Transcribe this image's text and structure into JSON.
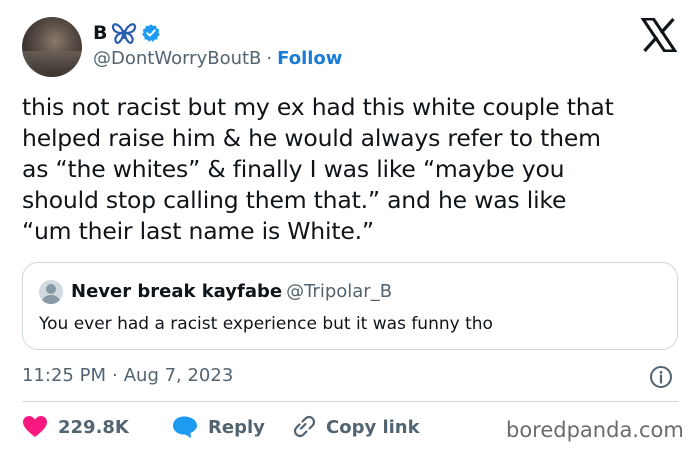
{
  "author": {
    "display_name": "B",
    "handle": "@DontWorryBoutB",
    "separator": "·",
    "follow_label": "Follow"
  },
  "tweet": {
    "lines": [
      "this not racist but my ex had this white couple that",
      "helped raise him & he would always refer to them",
      "as “the whites” & finally I was like “maybe you",
      "should stop calling them that.” and he was like",
      "“um their last name is White.”"
    ]
  },
  "quote": {
    "display_name": "Never break kayfabe",
    "handle": "@Tripolar_B",
    "text": "You ever had a racist experience but it was funny tho"
  },
  "meta": {
    "time": "11:25 PM",
    "separator": "·",
    "date": "Aug 7, 2023"
  },
  "actions": {
    "likes": "229.8K",
    "reply_label": "Reply",
    "copy_label": "Copy link"
  },
  "watermark": "boredpanda.com",
  "colors": {
    "accent": "#1d7bd8",
    "heart": "#f91880",
    "reply": "#1d9bf0",
    "muted": "#536471",
    "border": "#cfd9de"
  }
}
